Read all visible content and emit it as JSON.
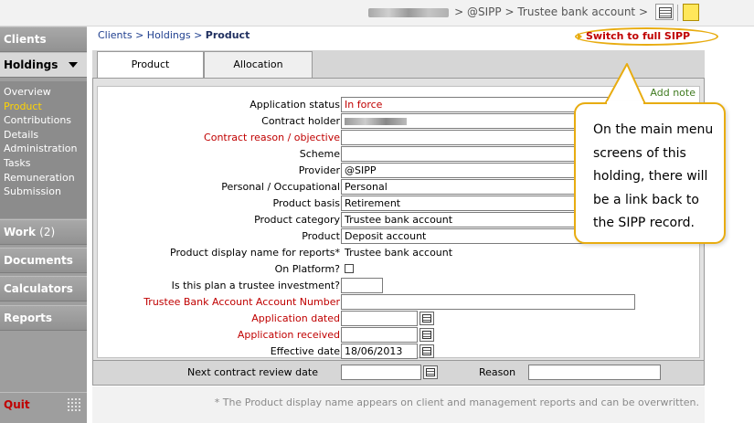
{
  "topbar": {
    "breadcrumb": "> @SIPP > Trustee bank account >",
    "calendar_icon": "calendar-icon",
    "note_icon": "sticky-note-icon"
  },
  "sidebar": {
    "clients": "Clients",
    "holdings": "Holdings",
    "sub_items": [
      "Overview",
      "Product",
      "Contributions",
      "Details",
      "Administration",
      "Tasks",
      "Remuneration",
      "Submission"
    ],
    "work_label": "Work",
    "work_count": "(2)",
    "documents": "Documents",
    "calculators": "Calculators",
    "reports": "Reports",
    "quit": "Quit"
  },
  "breadcrumb": {
    "clients": "Clients",
    "sep1": ">",
    "holdings": "Holdings",
    "sep2": ">",
    "current": "Product"
  },
  "switch_link": "Switch to full SIPP",
  "tabs": [
    "Product",
    "Allocation"
  ],
  "add_note": "Add note",
  "fields": [
    {
      "label": "Application status",
      "value": "In force"
    },
    {
      "label": "Contract holder",
      "value": ""
    },
    {
      "label": "Contract reason / objective",
      "value": ""
    },
    {
      "label": "Scheme",
      "value": ""
    },
    {
      "label": "Provider",
      "value": "@SIPP"
    },
    {
      "label": "Personal / Occupational",
      "value": "Personal"
    },
    {
      "label": "Product basis",
      "value": "Retirement"
    },
    {
      "label": "Product category",
      "value": "Trustee bank account"
    },
    {
      "label": "Product",
      "value": "Deposit account"
    },
    {
      "label": "Product display name for reports*",
      "value": "Trustee bank account"
    },
    {
      "label": "On Platform?",
      "value": ""
    },
    {
      "label": "Is this plan a trustee investment?",
      "value": ""
    },
    {
      "label": "Trustee Bank Account Account Number",
      "value": ""
    },
    {
      "label": "Application dated",
      "value": ""
    },
    {
      "label": "Application received",
      "value": ""
    },
    {
      "label": "Effective date",
      "value": "18/06/2013"
    }
  ],
  "bottom": {
    "review_label": "Next contract review date",
    "reason_label": "Reason"
  },
  "footnote": "* The Product display name appears on client and management reports and can be overwritten.",
  "callout": "On the main menu screens of this holding, there will be a link back to the SIPP record.",
  "colors": {
    "required_label": "#c00000",
    "active_nav": "#ffd400",
    "callout_border": "#e8ac10",
    "add_note": "#3f7a1f"
  }
}
